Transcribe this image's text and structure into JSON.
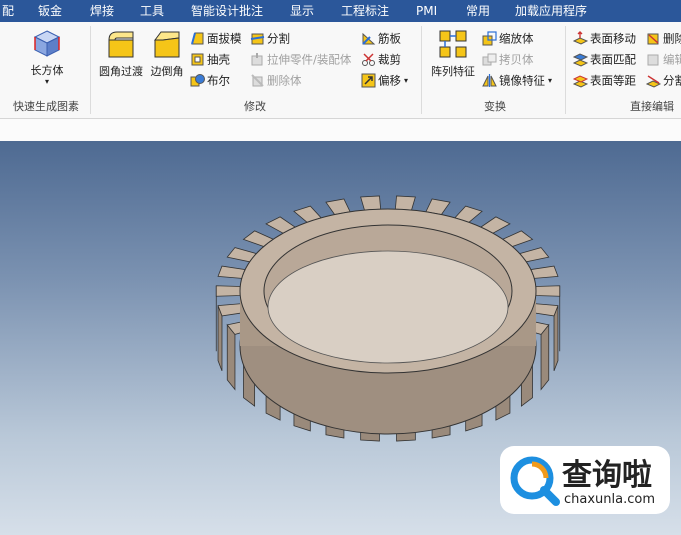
{
  "menu": [
    "配",
    "钣金",
    "焊接",
    "工具",
    "智能设计批注",
    "显示",
    "工程标注",
    "PMI",
    "常用",
    "加载应用程序"
  ],
  "groups": {
    "quick": {
      "label": "快速生成图素",
      "box": "长方体",
      "arrow": "▾"
    },
    "modify": {
      "label": "修改",
      "fillet": "圆角过渡",
      "chamfer": "边倒角",
      "draft": "面拔模",
      "shell": "抽壳",
      "boolean": "布尔",
      "split": "分割",
      "stretch": "拉伸零件/装配体",
      "delete": "删除体",
      "rib": "筋板",
      "trim": "裁剪",
      "offset": "偏移"
    },
    "transform": {
      "label": "变换",
      "pattern": "阵列特征",
      "scale": "缩放体",
      "copy": "拷贝体",
      "mirror": "镜像特征"
    },
    "direct": {
      "label": "直接编辑",
      "move_face": "表面移动",
      "match_face": "表面匹配",
      "offset_face": "表面等距",
      "delete_face": "删除",
      "edit": "编辑",
      "split2": "分割"
    }
  },
  "watermark": {
    "title": "查询啦",
    "url": "chaxunla.com"
  },
  "colors": {
    "menubar": "#2b579a",
    "gear": "#b8a796",
    "watermark_blue": "#1d8fe0",
    "watermark_orange": "#f19a1b"
  }
}
